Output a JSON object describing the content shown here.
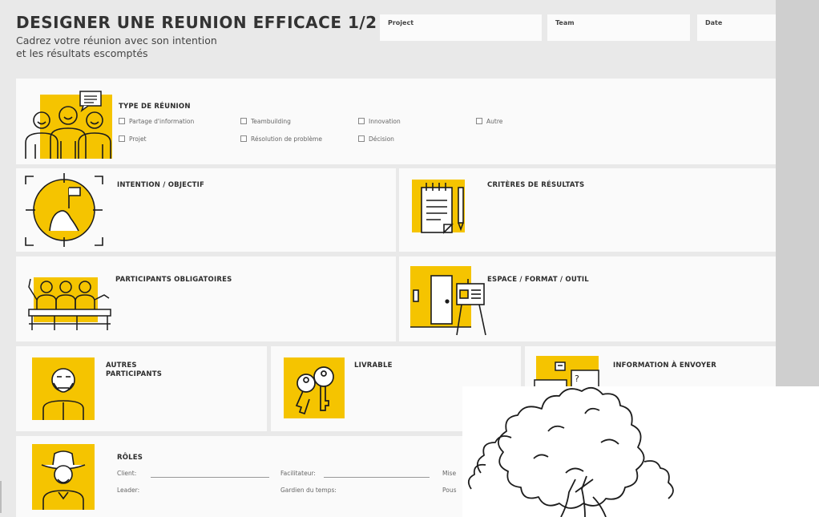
{
  "header": {
    "title": "DESIGNER UNE REUNION EFFICACE 1/2",
    "subtitle_line1": "Cadrez votre réunion avec son intention",
    "subtitle_line2": "et les résultats escomptés",
    "fields": {
      "project": "Project",
      "team": "Team",
      "date": "Date"
    }
  },
  "type_reunion": {
    "heading": "TYPE DE RÉUNION",
    "options": [
      "Partage d'information",
      "Teambuilding",
      "Innovation",
      "Autre",
      "Projet",
      "Résolution de problème",
      "Décision"
    ]
  },
  "sections": {
    "intention": "INTENTION / OBJECTIF",
    "criteres": "CRITÈRES DE RÉSULTATS",
    "participants": "PARTICIPANTS OBLIGATOIRES",
    "espace": "ESPACE / FORMAT / OUTIL",
    "autres_line1": "AUTRES",
    "autres_line2": "PARTICIPANTS",
    "livrable": "LIVRABLE",
    "information": "INFORMATION À ENVOYER",
    "roles": "RÔLES"
  },
  "roles": {
    "client": "Client:",
    "facilitateur": "Facilitateur:",
    "col3_top": "Mise",
    "leader": "Leader:",
    "gardien": "Gardien du temps:",
    "col3_bottom": "Pous"
  },
  "colors": {
    "accent": "#f5c400",
    "card": "#fafafa",
    "background": "#e9e9e9",
    "ink": "#1c1c1c"
  },
  "icons": [
    "team-icon",
    "target-icon",
    "notepad-icon",
    "audience-icon",
    "door-easel-icon",
    "bearded-person-icon",
    "keys-icon",
    "documents-icon",
    "cowboy-icon",
    "tree-sketch"
  ]
}
